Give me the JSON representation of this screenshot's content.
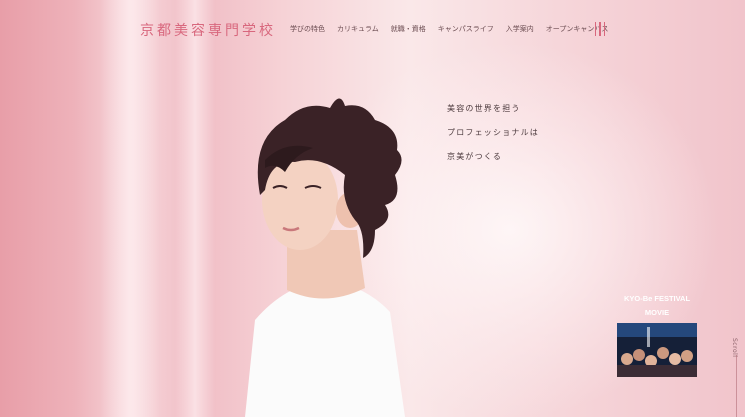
{
  "header": {
    "logo": "京都美容専門学校",
    "nav": [
      "学びの特色",
      "カリキュラム",
      "就職・資格",
      "キャンパスライフ",
      "入学案内",
      "オープンキャンパス"
    ]
  },
  "hero": {
    "copy": [
      "美容の世界を担う",
      "プロフェッショナルは",
      "京美がつくる"
    ]
  },
  "festival": {
    "title_line1": "KYO-Be FESTIVAL",
    "title_line2": "MOVIE"
  },
  "scroll_label": "Scroll",
  "colors": {
    "accent": "#d8677d",
    "background_left": "#e89ea8",
    "background_right": "#f1c4cb",
    "text": "#4c3a3d"
  },
  "icons": [
    "menu-icon",
    "play-thumbnail"
  ]
}
